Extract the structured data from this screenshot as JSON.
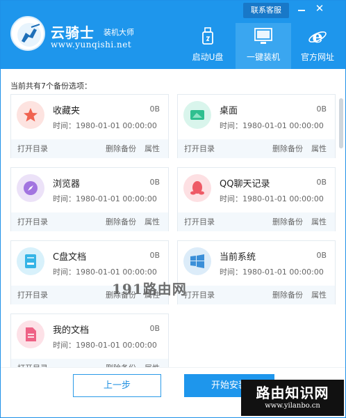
{
  "header": {
    "brand": "云骑士",
    "brand_sub": "装机大师",
    "url": "www.yunqishi.net",
    "service_label": "联系客服",
    "minimize_glyph": "—",
    "close_glyph": "✕",
    "nav": [
      {
        "label": "启动U盘",
        "icon": "usb-drive-icon"
      },
      {
        "label": "一键装机",
        "icon": "monitor-icon",
        "active": true
      },
      {
        "label": "官方网址",
        "icon": "ie-browser-icon"
      }
    ],
    "colors": {
      "header_bg": "#1e96ec",
      "active_tab": "#3aa6f0"
    }
  },
  "backup_count_label": "当前共有7个备份选项：",
  "cards": [
    {
      "name": "收藏夹",
      "size": "0B",
      "time": "时间：1980-01-01 00:00:00",
      "open": "打开目录",
      "delete": "删除备份",
      "props": "属性",
      "icon": "star-icon",
      "bg": "#fde3e0",
      "fg": "#f0624f"
    },
    {
      "name": "桌面",
      "size": "0B",
      "time": "时间：1980-01-01 00:00:00",
      "open": "打开目录",
      "delete": "删除备份",
      "props": "属性",
      "icon": "desktop-icon",
      "bg": "#d9f5ec",
      "fg": "#2fbf8f"
    },
    {
      "name": "浏览器",
      "size": "0B",
      "time": "时间：1980-01-01 00:00:00",
      "open": "打开目录",
      "delete": "删除备份",
      "props": "属性",
      "icon": "compass-icon",
      "bg": "#ece2f8",
      "fg": "#a274e0"
    },
    {
      "name": "QQ聊天记录",
      "size": "0B",
      "time": "时间：1980-01-01 00:00:00",
      "open": "打开目录",
      "delete": "删除备份",
      "props": "属性",
      "icon": "qq-penguin-icon",
      "bg": "#fde0e3",
      "fg": "#ee5a66"
    },
    {
      "name": "C盘文档",
      "size": "0B",
      "time": "时间：1980-01-01 00:00:00",
      "open": "打开目录",
      "delete": "删除备份",
      "props": "属性",
      "icon": "drive-icon",
      "bg": "#d8f1fb",
      "fg": "#35b4e6"
    },
    {
      "name": "当前系统",
      "size": "0B",
      "time": "时间：1980-01-01 00:00:00",
      "open": "打开目录",
      "delete": "删除备份",
      "props": "属性",
      "icon": "windows-logo-icon",
      "bg": "#dcecf9",
      "fg": "#3b8fd8"
    },
    {
      "name": "我的文档",
      "size": "0B",
      "time": "时间：1980-01-01 00:00:00",
      "open": "打开目录",
      "delete": "删除备份",
      "props": "属性",
      "icon": "document-icon",
      "bg": "#fde1e7",
      "fg": "#ee6185"
    }
  ],
  "watermark": "191路由网",
  "footer": {
    "prev_label": "上一步",
    "start_label": "开始安装"
  },
  "site_watermark": {
    "title": "路由知识网",
    "url": "www.yilanbo.cn"
  }
}
